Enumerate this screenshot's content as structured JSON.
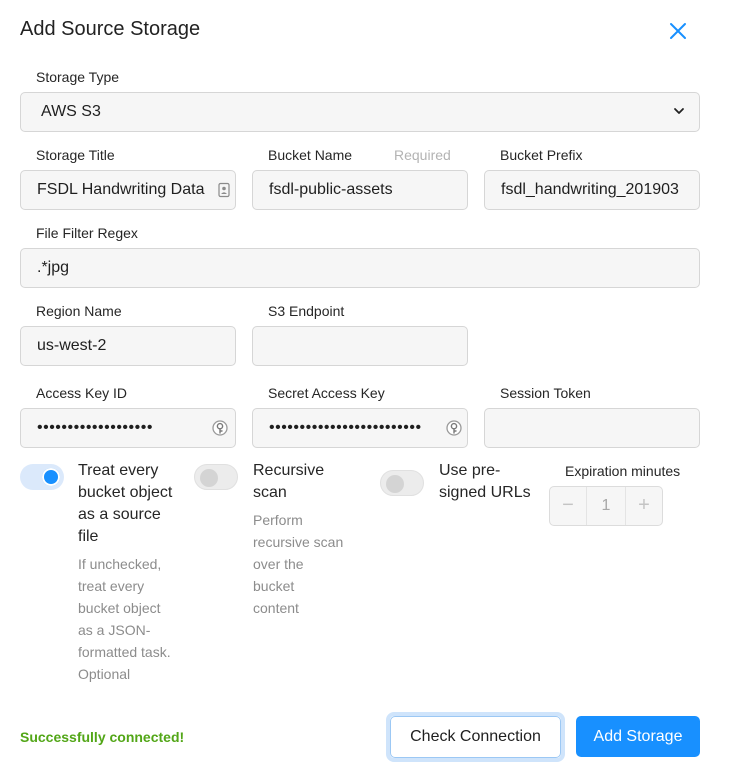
{
  "dialog": {
    "title": "Add Source Storage",
    "close_icon": "close-x-icon",
    "accent_color": "#1890ff",
    "success_color": "#52a617"
  },
  "storage_type": {
    "label": "Storage Type",
    "value": "AWS S3"
  },
  "storage_title": {
    "label": "Storage Title",
    "value": "FSDL Handwriting Data"
  },
  "bucket_name": {
    "label": "Bucket Name",
    "required_label": "Required",
    "value": "fsdl-public-assets"
  },
  "bucket_prefix": {
    "label": "Bucket Prefix",
    "value": "fsdl_handwriting_201903"
  },
  "file_filter_regex": {
    "label": "File Filter Regex",
    "value": ".*jpg"
  },
  "region_name": {
    "label": "Region Name",
    "value": "us-west-2"
  },
  "s3_endpoint": {
    "label": "S3 Endpoint",
    "value": ""
  },
  "access_key_id": {
    "label": "Access Key ID",
    "masked": "•••••••••••••••••••"
  },
  "secret_access_key": {
    "label": "Secret Access Key",
    "masked": "•••••••••••••••••••••••••"
  },
  "session_token": {
    "label": "Session Token",
    "value": ""
  },
  "options": {
    "treat_as_source": {
      "title_lines": [
        "Treat every",
        "bucket object",
        "as a source",
        "file"
      ],
      "help_lines": [
        "If unchecked,",
        "treat every",
        "bucket object",
        "as a JSON-",
        "formatted task.",
        "Optional"
      ],
      "checked": true
    },
    "recursive_scan": {
      "title_lines": [
        "Recursive",
        "scan"
      ],
      "help_lines": [
        "Perform",
        "recursive scan",
        "over the",
        "bucket",
        "content"
      ],
      "checked": false
    },
    "presigned_urls": {
      "title_lines": [
        "Use pre-",
        "signed URLs"
      ],
      "checked": false
    }
  },
  "expiration": {
    "label": "Expiration minutes",
    "value": "1",
    "minus": "−",
    "plus": "+"
  },
  "status": {
    "text": "Successfully connected!"
  },
  "footer": {
    "check_label": "Check Connection",
    "add_label": "Add Storage"
  }
}
